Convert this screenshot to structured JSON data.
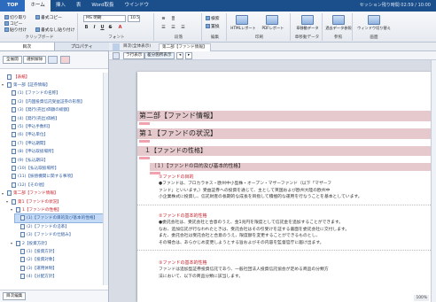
{
  "ribbon_tabs": [
    "TOP",
    "ホーム",
    "挿入",
    "表",
    "Word取扱",
    "ウインドウ"
  ],
  "user_status": "セッション残り時間 02:59 / 10:00",
  "clipboard": {
    "cut": "切り取り",
    "copy": "書式コピー",
    "paste": "貼り付け",
    "copy2": "コピー",
    "paste_text": "書式なし貼り付け",
    "label": "クリップボード"
  },
  "font": {
    "name": "MS 明朝",
    "size": "10.5",
    "bold": "B",
    "italic": "I",
    "underline": "U",
    "strike": "S",
    "label": "フォント"
  },
  "paragraph": {
    "label": "段落"
  },
  "find": {
    "search": "検索",
    "replace": "置換",
    "label": "編集"
  },
  "print": {
    "html": "HTMLレポート",
    "pdf": "PDFレポート",
    "label": "印刷"
  },
  "section": {
    "change": "章移動データ",
    "label": "章移動データ"
  },
  "reference": {
    "btn": "過去データ参照",
    "label": "参照"
  },
  "switch": {
    "btn": "ウィンドウ切り替え",
    "label": "画面"
  },
  "pane_tabs": [
    "目次",
    "プロパティ"
  ],
  "side_buttons": {
    "expand": "全展開",
    "collapse": "選択解除",
    "edit": "目次編集"
  },
  "tree": [
    {
      "label": "【表紙】",
      "red": true,
      "depth": 0
    },
    {
      "label": "第一部【証券情報】",
      "red": false,
      "depth": 0
    },
    {
      "label": "(1)【ファンドの名称】",
      "red": false,
      "depth": 1
    },
    {
      "label": "(2)【内国投資信託受益証券の形態】",
      "red": false,
      "depth": 1
    },
    {
      "label": "(3)【発行(売出)価額の総額】",
      "red": false,
      "depth": 1
    },
    {
      "label": "(4)【発行(売出)価格】",
      "red": false,
      "depth": 1
    },
    {
      "label": "(5)【申込手数料】",
      "red": false,
      "depth": 1
    },
    {
      "label": "(6)【申込単位】",
      "red": false,
      "depth": 1
    },
    {
      "label": "(7)【申込期間】",
      "red": false,
      "depth": 1
    },
    {
      "label": "(8)【申込取扱場所】",
      "red": false,
      "depth": 1
    },
    {
      "label": "(9)【払込期日】",
      "red": false,
      "depth": 1
    },
    {
      "label": "(10)【払込取扱場所】",
      "red": false,
      "depth": 1
    },
    {
      "label": "(11)【振替機関に関する事項】",
      "red": false,
      "depth": 1
    },
    {
      "label": "(12)【その他】",
      "red": false,
      "depth": 1
    },
    {
      "label": "第二部【ファンド情報】",
      "red": true,
      "depth": 0
    },
    {
      "label": "第1【ファンドの状況】",
      "red": true,
      "depth": 1
    },
    {
      "label": "1【ファンドの性格】",
      "red": true,
      "depth": 2
    },
    {
      "label": "(1)【ファンドの目的及び基本的性格】",
      "red": false,
      "depth": 3,
      "sel": true
    },
    {
      "label": "(2)【ファンドの沿革】",
      "red": false,
      "depth": 3
    },
    {
      "label": "(3)【ファンドの仕組み】",
      "red": false,
      "depth": 3
    },
    {
      "label": "2【投資方針】",
      "red": false,
      "depth": 2
    },
    {
      "label": "(1)【投資方針】",
      "red": false,
      "depth": 3
    },
    {
      "label": "(2)【投資対象】",
      "red": false,
      "depth": 3
    },
    {
      "label": "(3)【運用体制】",
      "red": false,
      "depth": 3
    },
    {
      "label": "(4)【分配方針】",
      "red": false,
      "depth": 3
    }
  ],
  "doc_tabs": [
    "目次(全体表示)",
    "第二部【ファンド情報】"
  ],
  "doc_buttons": {
    "a": "ラ行表示",
    "b": "差分箇所表示"
  },
  "doc": {
    "h1": "第二部【ファンド情報】",
    "h2": "第１【ファンドの状況】",
    "h3": "１【ファンドの性格】",
    "h4": "（１）【ファンドの目的及び基本的性格】",
    "s1_title": "①ファンドの目的",
    "s1_lines": [
      "●ファンドは、ブロカラキス・欧州中小型株・オープン・マザーファンド（以下「マザーフ",
      "ァンド」といいます。）受益証券への投資を通じて、主として英国および欧州大陸の欧州中",
      "小企業株式に投資し、信託財産の長期的な成長を目指して積極的な運用を行なうことを基本としています。"
    ],
    "s2_title": "②ファンドの基本的性格",
    "s2_lines": [
      "●委託会社は、受託会社と合意のうえ、金1兆円を限度として信託金を追加することができます。",
      "なお、追加信託が行なわれたときは、受託会社はその引受けを証する書面を委託会社に交付します。",
      "また、委託会社は受託会社と合意のうえ、限度額を変更することができるものとし、",
      "その場合は、あらかじめ変更しようとする旨およびその内容を監督官庁に届け出ます。"
    ],
    "s3_title": "③ファンドの基本的性格",
    "s3_lines": [
      "ファンドは追加型証券投資信託であり、一般社団法人投資信託協会が定める商品の分類方",
      "法において、以下の商品分類に該当します。"
    ]
  },
  "zoom": "100%"
}
